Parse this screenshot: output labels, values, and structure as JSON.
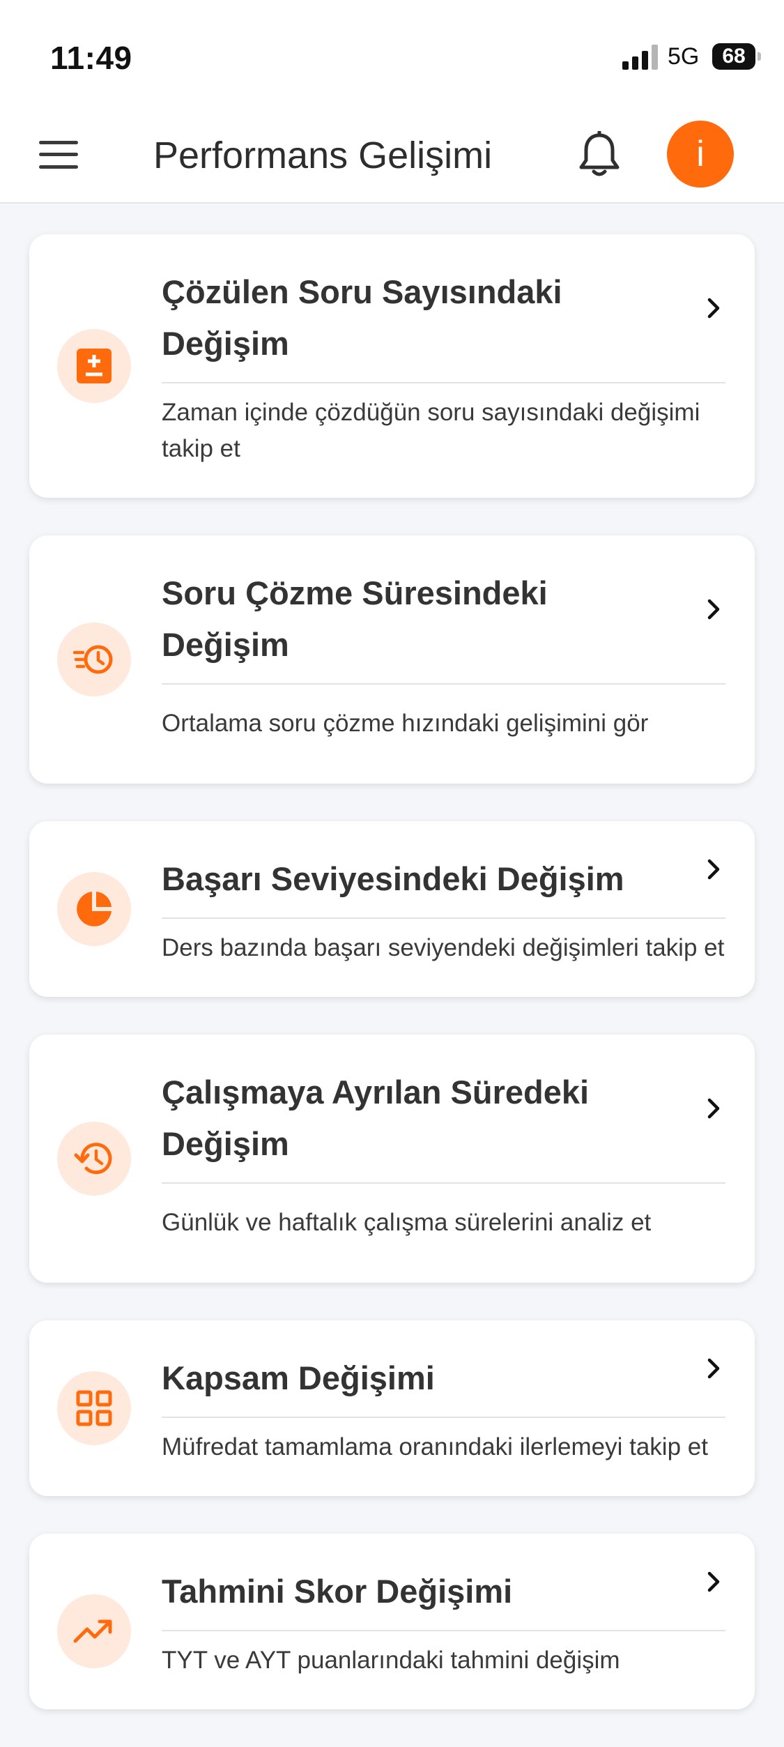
{
  "status": {
    "time": "11:49",
    "network": "5G",
    "battery": "68"
  },
  "header": {
    "title": "Performans Gelişimi",
    "avatar_letter": "i"
  },
  "colors": {
    "accent": "#ff6a0d",
    "icon_bg": "#ffe9dd"
  },
  "cards": [
    {
      "icon": "plus-minus-icon",
      "title": "Çözülen Soru Sayısındaki Değişim",
      "description": "Zaman içinde çözdüğün soru sayısındaki değişimi takip et"
    },
    {
      "icon": "timer-speed-icon",
      "title": "Soru Çözme Süresindeki Değişim",
      "description": "Ortalama soru çözme hızındaki gelişimini gör"
    },
    {
      "icon": "pie-chart-icon",
      "title": "Başarı Seviyesindeki Değişim",
      "description": "Ders bazında başarı seviyendeki değişimleri takip et"
    },
    {
      "icon": "history-icon",
      "title": "Çalışmaya Ayrılan Süredeki Değişim",
      "description": "Günlük ve haftalık çalışma sürelerini analiz et"
    },
    {
      "icon": "grid-icon",
      "title": "Kapsam Değişimi",
      "description": "Müfredat tamamlama oranındaki ilerlemeyi takip et"
    },
    {
      "icon": "trending-up-icon",
      "title": "Tahmini Skor Değişimi",
      "description": "TYT ve AYT puanlarındaki tahmini değişim"
    }
  ]
}
